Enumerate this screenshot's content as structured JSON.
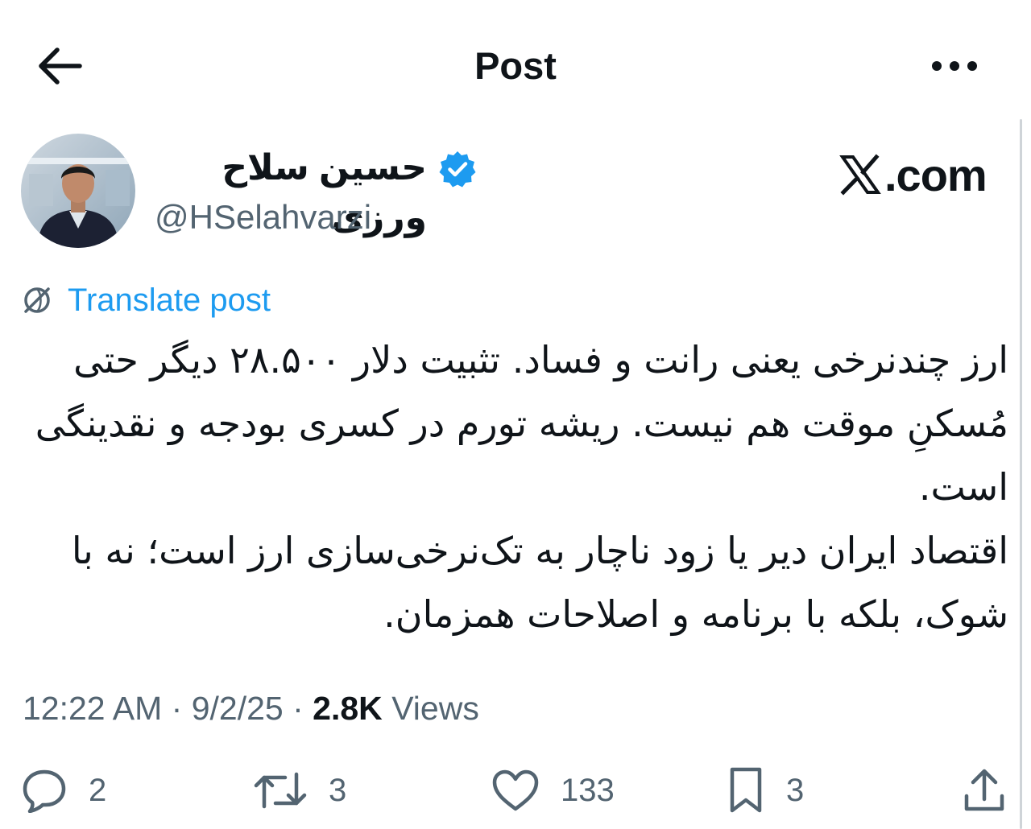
{
  "header": {
    "title": "Post",
    "back_icon": "arrow-left-icon",
    "more_icon": "more-horizontal-icon"
  },
  "author": {
    "display_name": "حسین سلاح ورزی",
    "handle": "@HSelahvarzi",
    "verified": true,
    "verified_color": "#1d9bf0"
  },
  "watermark": {
    "text": ".com",
    "logo": "x-logo-icon"
  },
  "translate": {
    "label": "Translate post",
    "icon": "translate-globe-icon",
    "color": "#1d9bf0"
  },
  "post": {
    "paragraphs": [
      "ارز چندنرخی یعنی رانت و فساد. تثبیت دلار ۲۸.۵۰۰ دیگر حتی مُسکنِ موقت هم نیست. ریشه تورم در کسری بودجه و نقدینگی است.",
      "اقتصاد ایران دیر یا زود ناچار به تک‌نرخی‌سازی ارز است؛ نه با شوک، بلکه با برنامه و اصلاحات همزمان."
    ]
  },
  "meta": {
    "time": "12:22 AM",
    "date": "9/2/25",
    "views_count": "2.8K",
    "views_label": "Views",
    "separator": "·"
  },
  "actions": {
    "reply": {
      "icon": "reply-icon",
      "count": "2"
    },
    "retweet": {
      "icon": "retweet-icon",
      "count": "3"
    },
    "like": {
      "icon": "heart-icon",
      "count": "133"
    },
    "bookmark": {
      "icon": "bookmark-icon",
      "count": "3"
    },
    "share": {
      "icon": "share-icon"
    }
  },
  "colors": {
    "text": "#0f1419",
    "secondary": "#536471",
    "accent": "#1d9bf0"
  }
}
